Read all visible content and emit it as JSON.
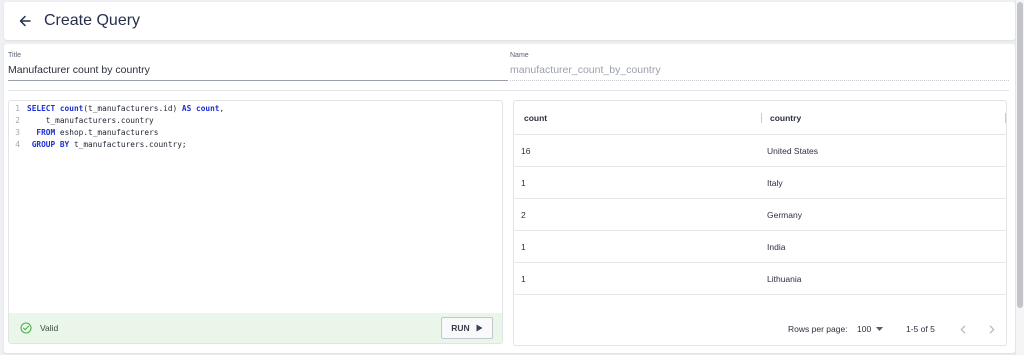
{
  "header": {
    "title": "Create Query",
    "back_icon": "arrow-left-icon"
  },
  "form": {
    "title_label": "Title",
    "title_value": "Manufacturer count by country",
    "name_label": "Name",
    "name_value": "manufacturer_count_by_country"
  },
  "editor": {
    "lines": [
      {
        "num": "1",
        "parts": [
          [
            "kw",
            "SELECT "
          ],
          [
            "kw",
            "count"
          ],
          [
            "tx",
            "(t_manufacturers.id) "
          ],
          [
            "kw",
            "AS "
          ],
          [
            "kw",
            "count"
          ],
          [
            "tx",
            ","
          ]
        ]
      },
      {
        "num": "2",
        "parts": [
          [
            "tx",
            "    t_manufacturers.country"
          ]
        ]
      },
      {
        "num": "3",
        "parts": [
          [
            "tx",
            "  "
          ],
          [
            "kw",
            "FROM "
          ],
          [
            "tx",
            "eshop.t_manufacturers"
          ]
        ]
      },
      {
        "num": "4",
        "parts": [
          [
            "tx",
            " "
          ],
          [
            "kw",
            "GROUP BY "
          ],
          [
            "tx",
            "t_manufacturers.country;"
          ]
        ]
      }
    ],
    "status_label": "Valid",
    "status_icon": "check-circle-icon",
    "run_label": "RUN",
    "run_icon": "play-icon"
  },
  "results": {
    "columns": [
      "count",
      "country"
    ],
    "rows": [
      {
        "count": "16",
        "country": "United States"
      },
      {
        "count": "1",
        "country": "Italy"
      },
      {
        "count": "2",
        "country": "Germany"
      },
      {
        "count": "1",
        "country": "India"
      },
      {
        "count": "1",
        "country": "Lithuania"
      }
    ],
    "rows_per_page_label": "Rows per page:",
    "rows_per_page_value": "100",
    "range_label": "1-5 of 5"
  },
  "colors": {
    "keyword": "#1d2fd4",
    "valid_bg": "#eaf6ea",
    "valid_icon": "#4caf50"
  }
}
